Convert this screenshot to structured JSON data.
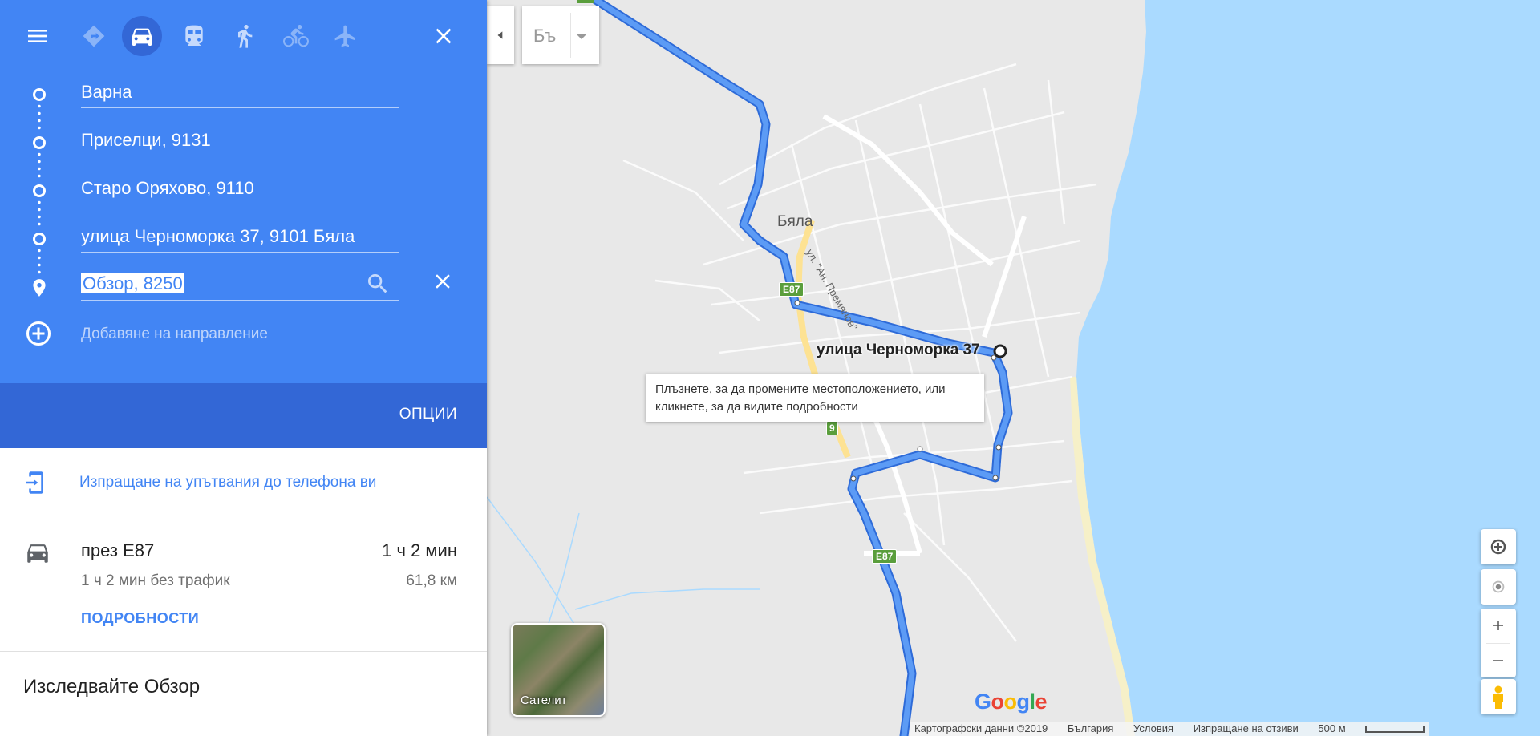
{
  "panel": {
    "travel_modes": [
      {
        "name": "best-mode",
        "icon": "directions-diamond-icon",
        "active": false
      },
      {
        "name": "driving",
        "icon": "car-icon",
        "active": true
      },
      {
        "name": "transit",
        "icon": "train-icon",
        "active": false
      },
      {
        "name": "walking",
        "icon": "walking-icon",
        "active": false
      },
      {
        "name": "cycling",
        "icon": "bicycle-icon",
        "active": false
      },
      {
        "name": "flights",
        "icon": "airplane-icon",
        "active": false
      }
    ],
    "waypoints": [
      {
        "value": "Варна"
      },
      {
        "value": "Приселци, 9131"
      },
      {
        "value": "Старо Оряхово, 9110"
      },
      {
        "value": "улица Черноморка 37, 9101 Бяла"
      },
      {
        "value": "Обзор, 8250"
      }
    ],
    "add_destination": "Добавяне на направление",
    "options": "ОПЦИИ",
    "send_to_phone": "Изпращане на упътвания до телефона ви",
    "route": {
      "via": "през E87",
      "time": "1 ч 2 мин",
      "no_traffic": "1 ч 2 мин без трафик",
      "distance": "61,8 км",
      "details": "ПОДРОБНОСТИ"
    },
    "explore": "Изследвайте Обзор",
    "colors": {
      "header": "#4285f4",
      "options_bar": "#3367d6",
      "link": "#4285f4"
    }
  },
  "map": {
    "layers_label": "Бъ",
    "town": "Бяла",
    "street": "ул. \"Ан. Премянов\"",
    "road_e87": "E87",
    "road_9": "9",
    "pin_label": "улица Черноморка 37",
    "tooltip": "Плъзнете, за да промените местоположението, или кликнете, за да видите подробности",
    "satellite": "Сателит",
    "google": "Google",
    "attribution": [
      "Картографски данни ©2019",
      "България",
      "Условия",
      "Изпращане на отзиви",
      "500 м"
    ],
    "colors": {
      "route": "#4a8af4",
      "sea": "#aadaff",
      "land": "#e8e8e8",
      "beach": "#f6f0c8"
    }
  }
}
